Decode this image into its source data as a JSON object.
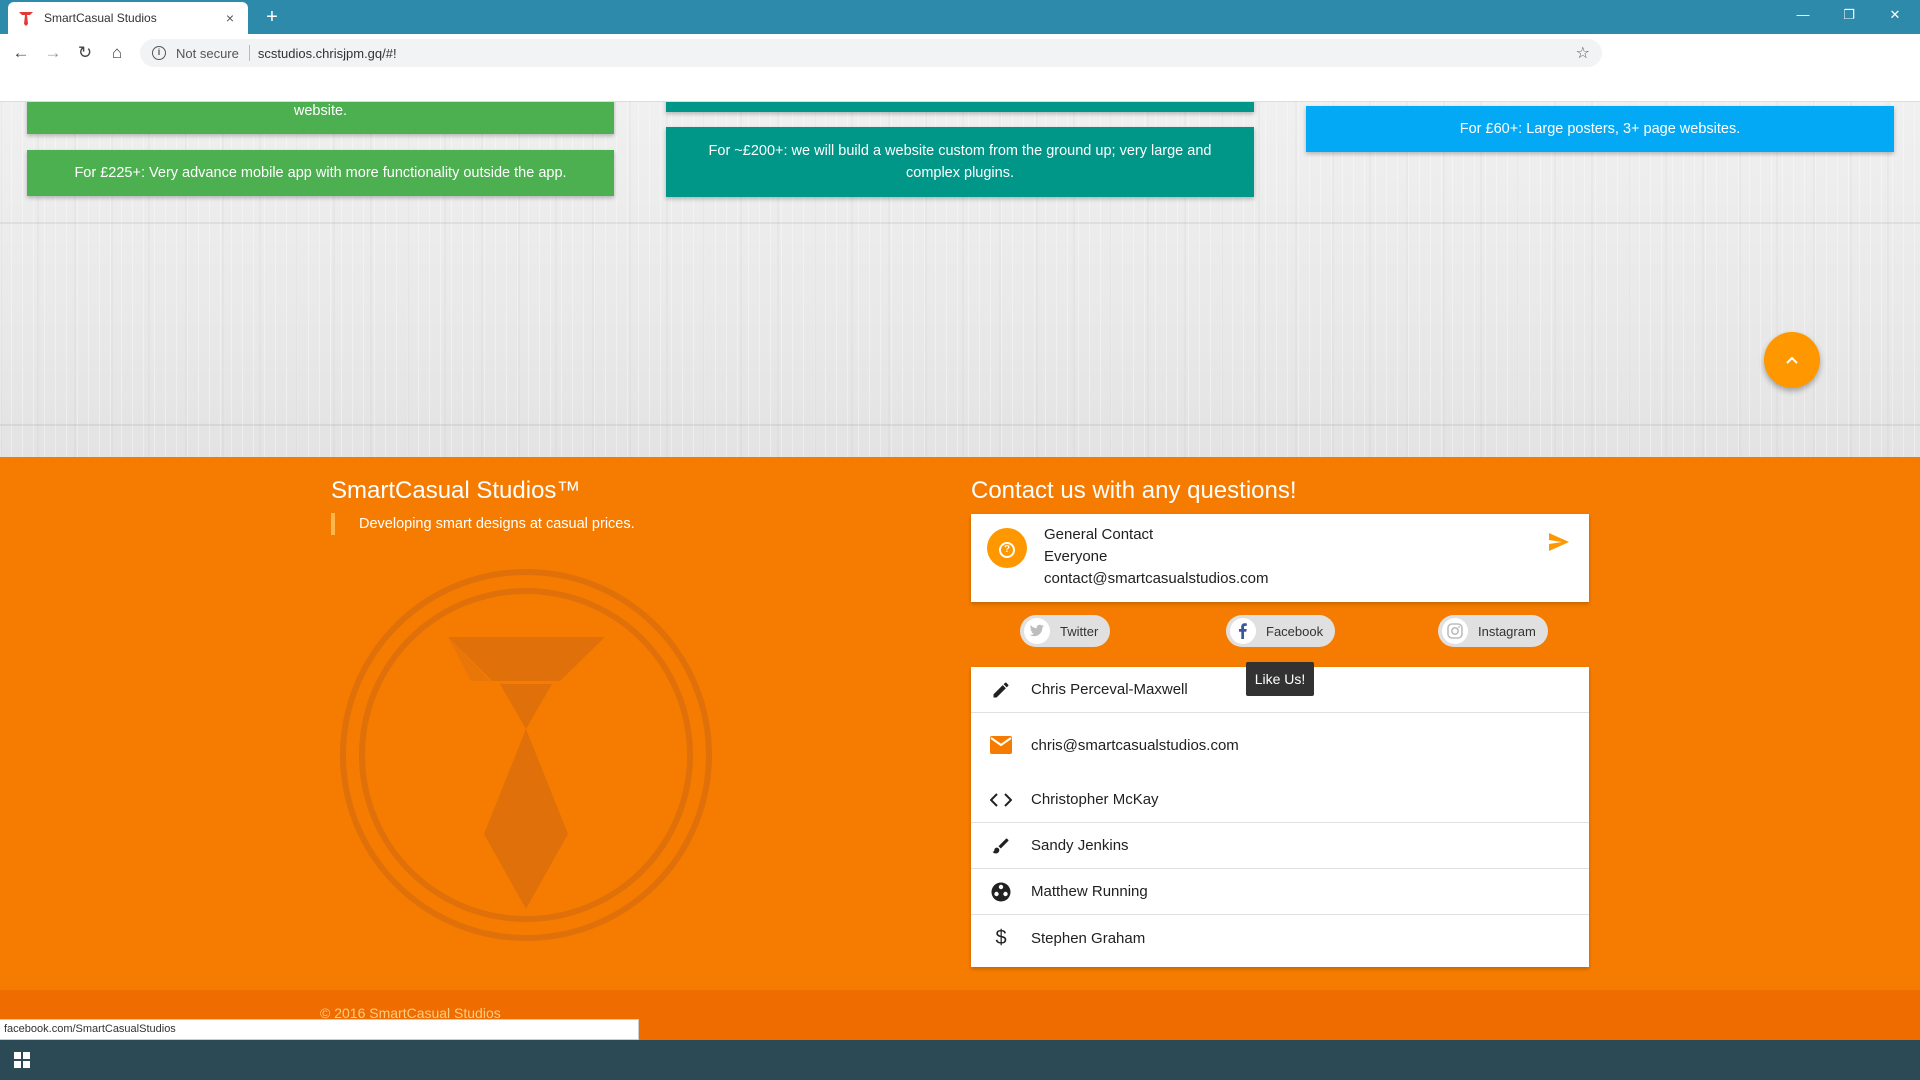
{
  "browser": {
    "tab_title": "SmartCasual Studios",
    "tab_close": "×",
    "new_tab": "+",
    "not_secure": "Not secure",
    "url": "scstudios.chrisjpm.gq/#!",
    "status_url": "facebook.com/SmartCasualStudios"
  },
  "cards": [
    {
      "text": "website.",
      "color": "#4caf50"
    },
    {
      "text": "For £225+: Very advance mobile app with more functionality outside the app.",
      "color": "#4caf50"
    },
    {
      "text": "For ~£200+: we will build a website custom from the ground up; very large and complex plugins.",
      "color": "#009688"
    },
    {
      "text": "For £60+: Large posters, 3+ page websites.",
      "color": "#03a9f4"
    }
  ],
  "footer": {
    "brand": "SmartCasual Studios™",
    "tagline": "Developing smart designs at casual prices.",
    "contact_heading": "Contact us with any questions!",
    "contact": {
      "title": "General Contact",
      "audience": "Everyone",
      "email": "contact@smartcasualstudios.com"
    },
    "social": [
      {
        "label": "Twitter",
        "icon": "twitter-icon"
      },
      {
        "label": "Facebook",
        "icon": "facebook-icon"
      },
      {
        "label": "Instagram",
        "icon": "instagram-icon"
      }
    ],
    "tooltip": "Like Us!",
    "team": [
      {
        "name": "Chris Perceval-Maxwell",
        "icon": "pencil-icon"
      },
      {
        "name": "chris@smartcasualstudios.com",
        "icon": "mail-icon"
      },
      {
        "name": "Christopher McKay",
        "icon": "code-icon"
      },
      {
        "name": "Sandy Jenkins",
        "icon": "brush-icon"
      },
      {
        "name": "Matthew Running",
        "icon": "film-reel-icon"
      },
      {
        "name": "Stephen Graham",
        "icon": "dollar-icon"
      }
    ],
    "copyright": "© 2016 SmartCasual Studios"
  },
  "colors": {
    "footer": "#f57c00",
    "accent": "#ff9800",
    "green": "#4caf50",
    "teal": "#009688",
    "blue": "#03a9f4"
  }
}
